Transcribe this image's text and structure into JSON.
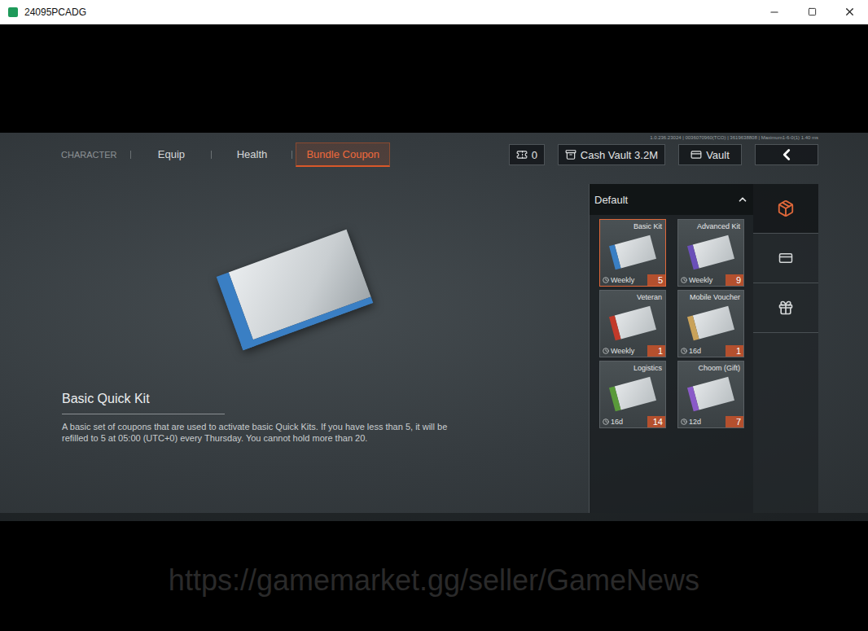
{
  "window": {
    "title": "24095PCADG"
  },
  "version_text": "1.0.236.23024 | 0036070960(TCO) | 3619638808 | Maximum1-6-0(1) 1.40 ms",
  "tabs": [
    {
      "label": "CHARACTER",
      "selected": false
    },
    {
      "label": "Equip",
      "selected": false
    },
    {
      "label": "Health",
      "selected": false
    },
    {
      "label": "Bundle Coupon",
      "selected": true
    }
  ],
  "currency": {
    "count": "0"
  },
  "cash_vault": "Cash Vault 3.2M",
  "vault": "Vault",
  "inventory": {
    "header": "Default",
    "expanded": true,
    "items": [
      {
        "name": "Basic Kit",
        "timer": "Weekly",
        "count": "5",
        "selected": true,
        "color": "#3a7fc4"
      },
      {
        "name": "Advanced Kit",
        "timer": "Weekly",
        "count": "9",
        "selected": false,
        "color": "#6a4fb8"
      },
      {
        "name": "Veteran",
        "timer": "Weekly",
        "count": "1",
        "selected": false,
        "color": "#c23a2a"
      },
      {
        "name": "Mobile Voucher",
        "timer": "16d",
        "count": "1",
        "selected": false,
        "color": "#c9a25a"
      },
      {
        "name": "Logistics",
        "timer": "16d",
        "count": "14",
        "selected": false,
        "color": "#5a9a3a"
      },
      {
        "name": "Choom (Gift)",
        "timer": "12d",
        "count": "7",
        "selected": false,
        "color": "#8a5ac8"
      }
    ]
  },
  "side_tabs": [
    {
      "kind": "chest",
      "selected": true
    },
    {
      "kind": "card",
      "selected": false
    },
    {
      "kind": "gift",
      "selected": false
    }
  ],
  "detail": {
    "title": "Basic Quick Kit",
    "description": "A basic set of coupons that are used to activate basic Quick Kits. If you have less than 5, it will be refilled to 5 at 05:00 (UTC+0) every Thursday. You cannot hold more than 20."
  },
  "watermark": "https://gamemarket.gg/seller/GameNews"
}
